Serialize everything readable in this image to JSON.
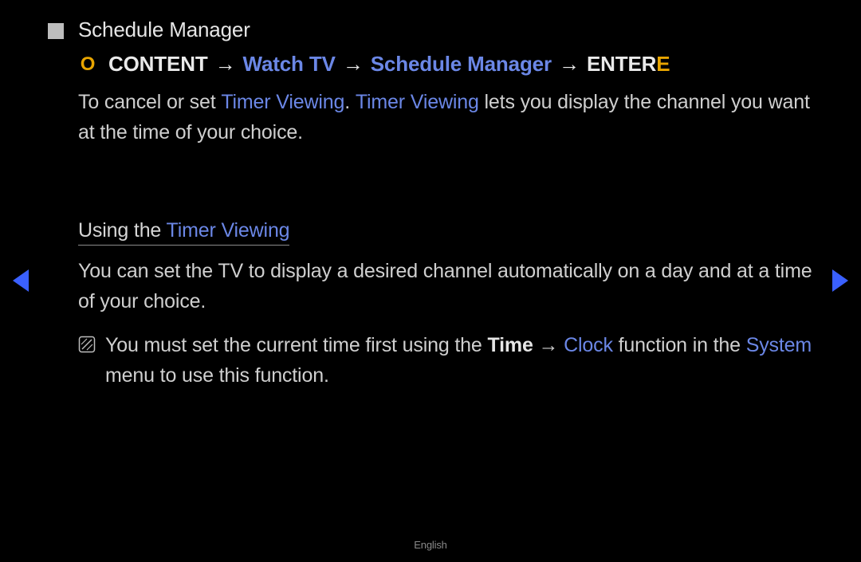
{
  "title": "Schedule Manager",
  "breadcrumb": {
    "content": "CONTENT",
    "arrow": "→",
    "watch_tv": "Watch TV",
    "schedule_manager": "Schedule Manager",
    "enter_prefix": "ENTER",
    "enter_e": "E"
  },
  "para1": {
    "pre": "To cancel or set ",
    "tv1": "Timer Viewing",
    "mid": ". ",
    "tv2": "Timer Viewing",
    "post": " lets you display the channel you want at the time of your choice."
  },
  "subhead": {
    "pre": "Using the ",
    "tv": "Timer Viewing"
  },
  "para2": "You can set the TV to display a desired channel automatically on a day and at a time of your choice.",
  "note": {
    "pre": "You must set the current time first using the ",
    "time": "Time",
    "arrow": " → ",
    "clock": "Clock",
    "mid": " function in the ",
    "system": "System",
    "post": " menu to use this function."
  },
  "footer": {
    "language": "English"
  }
}
